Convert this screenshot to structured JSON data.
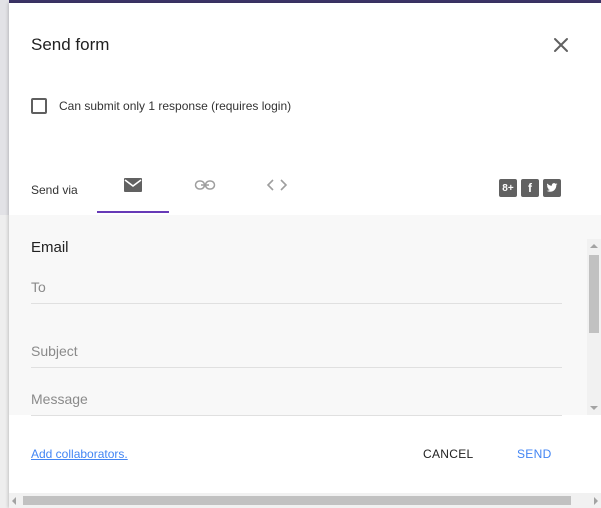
{
  "dialog": {
    "title": "Send form",
    "close_icon": "close-icon"
  },
  "option": {
    "checkbox_label": "Can submit only 1 response (requires login)",
    "checked": false
  },
  "send_via": {
    "label": "Send via",
    "tabs": [
      {
        "icon": "email-icon",
        "active": true
      },
      {
        "icon": "link-icon",
        "active": false
      },
      {
        "icon": "embed-code-icon",
        "active": false
      }
    ],
    "social": [
      {
        "icon": "google-plus-icon",
        "glyph": "8+"
      },
      {
        "icon": "facebook-icon",
        "glyph": "f"
      },
      {
        "icon": "twitter-icon",
        "glyph": "t"
      }
    ]
  },
  "email": {
    "heading": "Email",
    "to_placeholder": "To",
    "subject_placeholder": "Subject",
    "message_placeholder": "Message"
  },
  "footer": {
    "add_collaborators": "Add collaborators.",
    "cancel": "CANCEL",
    "send": "SEND"
  },
  "colors": {
    "accent": "#673ab7",
    "link": "#4285f4",
    "text": "#212121"
  }
}
